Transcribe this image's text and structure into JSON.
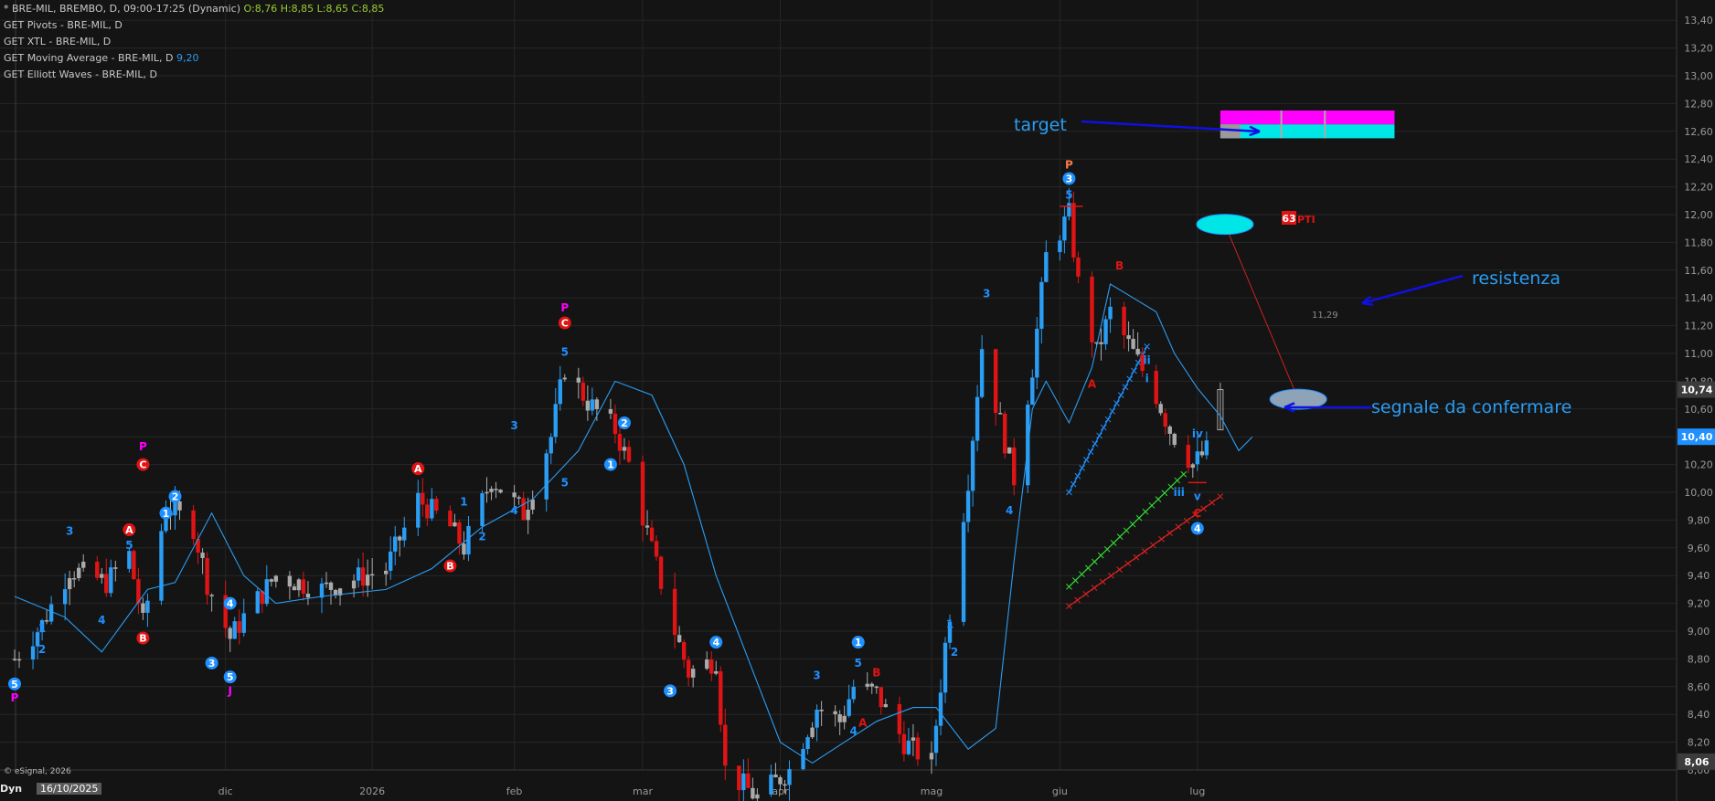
{
  "header": {
    "symbol_line": "* BRE-MIL, BREMBO, D, 09:00-17:25 (Dynamic)",
    "ohlc": "O:8,76 H:8,85 L:8,65 C:8,85",
    "studies": [
      {
        "label": "GET Pivots - BRE-MIL, D",
        "value": ""
      },
      {
        "label": "GET XTL - BRE-MIL, D",
        "value": ""
      },
      {
        "label": "GET Moving Average - BRE-MIL, D",
        "value": "9,20"
      },
      {
        "label": "GET Elliott Waves - BRE-MIL, D",
        "value": ""
      }
    ]
  },
  "footer": {
    "copyright": "© eSignal, 2026",
    "mode": "Dyn",
    "cursor_date": "16/10/2025"
  },
  "colors": {
    "background": "#141414",
    "grid": "#262626",
    "up_candle": "#2a9df4",
    "down_candle": "#e01414",
    "neutral_candle": "#aaaaaa",
    "moving_average": "#2a9df4",
    "annotation_arrow": "#1010e0",
    "annotation_text": "#2a9df4",
    "target_magenta": "#ff00ff",
    "target_cyan": "#00e6e6",
    "wave_red": "#e01414",
    "wave_blue": "#1e90ff",
    "wave_magenta": "#ff00ff"
  },
  "chart_data": {
    "type": "candlestick",
    "title": "",
    "xlabel": "",
    "ylabel": "",
    "ylim": [
      8.0,
      13.6
    ],
    "grid": true,
    "y_ticks": [
      "8,00",
      "8,20",
      "8,40",
      "8,60",
      "8,80",
      "9,00",
      "9,20",
      "9,40",
      "9,60",
      "9,80",
      "10,00",
      "10,20",
      "10,40",
      "10,60",
      "10,80",
      "11,00",
      "11,20",
      "11,40",
      "11,60",
      "11,80",
      "12,00",
      "12,20",
      "12,40",
      "12,60",
      "12,80",
      "13,00",
      "13,20",
      "13,40"
    ],
    "x_labels": [
      {
        "label": "dic",
        "date": "2025-12-01"
      },
      {
        "label": "2026",
        "date": "2026-01-02"
      },
      {
        "label": "feb",
        "date": "2026-02-02"
      },
      {
        "label": "mar",
        "date": "2026-03-02"
      },
      {
        "label": "apr",
        "date": "2026-04-01"
      },
      {
        "label": "mag",
        "date": "2026-05-04"
      },
      {
        "label": "giu",
        "date": "2026-06-01"
      },
      {
        "label": "lug",
        "date": "2026-07-01"
      }
    ],
    "date_range": [
      "2025-10-16",
      "2026-07-13"
    ],
    "price_badges": [
      {
        "value": 10.74,
        "label": "10,74",
        "style": "gray"
      },
      {
        "value": 10.4,
        "label": "10,40",
        "style": "blue"
      },
      {
        "value": 8.06,
        "label": "8,06",
        "style": "gray"
      }
    ],
    "series": [
      {
        "name": "",
        "type": "candlestick",
        "anchors": [
          {
            "date": "2025-10-16",
            "close": 8.8
          },
          {
            "date": "2025-10-22",
            "close": 9.05
          },
          {
            "date": "2025-10-28",
            "close": 9.45
          },
          {
            "date": "2025-11-05",
            "close": 9.35
          },
          {
            "date": "2025-11-10",
            "close": 9.55
          },
          {
            "date": "2025-11-13",
            "close": 9.05
          },
          {
            "date": "2025-11-18",
            "close": 9.9
          },
          {
            "date": "2025-11-24",
            "close": 9.75
          },
          {
            "date": "2025-11-27",
            "close": 9.35
          },
          {
            "date": "2025-12-02",
            "close": 8.95
          },
          {
            "date": "2025-12-05",
            "close": 9.1
          },
          {
            "date": "2025-12-12",
            "close": 9.4
          },
          {
            "date": "2025-12-22",
            "close": 9.3
          },
          {
            "date": "2026-01-05",
            "close": 9.45
          },
          {
            "date": "2026-01-12",
            "close": 9.95
          },
          {
            "date": "2026-01-19",
            "close": 9.75
          },
          {
            "date": "2026-01-22",
            "close": 9.6
          },
          {
            "date": "2026-01-28",
            "close": 10.1
          },
          {
            "date": "2026-02-04",
            "close": 9.85
          },
          {
            "date": "2026-02-10",
            "close": 10.4
          },
          {
            "date": "2026-02-13",
            "close": 10.9
          },
          {
            "date": "2026-02-18",
            "close": 10.65
          },
          {
            "date": "2026-02-24",
            "close": 10.45
          },
          {
            "date": "2026-02-27",
            "close": 10.2
          },
          {
            "date": "2026-03-03",
            "close": 9.7
          },
          {
            "date": "2026-03-09",
            "close": 9.0
          },
          {
            "date": "2026-03-12",
            "close": 8.7
          },
          {
            "date": "2026-03-18",
            "close": 8.8
          },
          {
            "date": "2026-03-20",
            "close": 8.0
          },
          {
            "date": "2026-03-27",
            "close": 7.8
          },
          {
            "date": "2026-04-03",
            "close": 8.0
          },
          {
            "date": "2026-04-09",
            "close": 8.45
          },
          {
            "date": "2026-04-14",
            "close": 8.35
          },
          {
            "date": "2026-04-17",
            "close": 8.6
          },
          {
            "date": "2026-04-22",
            "close": 8.55
          },
          {
            "date": "2026-04-28",
            "close": 8.2
          },
          {
            "date": "2026-05-04",
            "close": 8.05
          },
          {
            "date": "2026-05-07",
            "close": 8.9
          },
          {
            "date": "2026-05-12",
            "close": 10.1
          },
          {
            "date": "2026-05-15",
            "close": 11.05
          },
          {
            "date": "2026-05-19",
            "close": 10.5
          },
          {
            "date": "2026-05-22",
            "close": 10.1
          },
          {
            "date": "2026-05-26",
            "close": 10.9
          },
          {
            "date": "2026-05-29",
            "close": 11.7
          },
          {
            "date": "2026-06-03",
            "close": 12.0
          },
          {
            "date": "2026-06-05",
            "close": 11.5
          },
          {
            "date": "2026-06-09",
            "close": 11.0
          },
          {
            "date": "2026-06-12",
            "close": 11.3
          },
          {
            "date": "2026-06-17",
            "close": 11.0
          },
          {
            "date": "2026-06-22",
            "close": 10.7
          },
          {
            "date": "2026-06-25",
            "close": 10.45
          },
          {
            "date": "2026-06-30",
            "close": 10.2
          },
          {
            "date": "2026-07-03",
            "close": 10.3
          },
          {
            "date": "2026-07-06",
            "close": 10.74
          }
        ]
      },
      {
        "name": "",
        "type": "line",
        "points": [
          {
            "date": "2025-10-16",
            "value": 9.25
          },
          {
            "date": "2025-10-27",
            "value": 9.1
          },
          {
            "date": "2025-11-04",
            "value": 8.85
          },
          {
            "date": "2025-11-14",
            "value": 9.3
          },
          {
            "date": "2025-11-20",
            "value": 9.35
          },
          {
            "date": "2025-11-28",
            "value": 9.85
          },
          {
            "date": "2025-12-05",
            "value": 9.4
          },
          {
            "date": "2025-12-12",
            "value": 9.2
          },
          {
            "date": "2025-12-22",
            "value": 9.25
          },
          {
            "date": "2026-01-05",
            "value": 9.3
          },
          {
            "date": "2026-01-15",
            "value": 9.45
          },
          {
            "date": "2026-01-26",
            "value": 9.75
          },
          {
            "date": "2026-02-06",
            "value": 9.95
          },
          {
            "date": "2026-02-16",
            "value": 10.3
          },
          {
            "date": "2026-02-24",
            "value": 10.8
          },
          {
            "date": "2026-03-04",
            "value": 10.7
          },
          {
            "date": "2026-03-11",
            "value": 10.2
          },
          {
            "date": "2026-03-18",
            "value": 9.4
          },
          {
            "date": "2026-03-25",
            "value": 8.8
          },
          {
            "date": "2026-04-01",
            "value": 8.2
          },
          {
            "date": "2026-04-08",
            "value": 8.05
          },
          {
            "date": "2026-04-15",
            "value": 8.2
          },
          {
            "date": "2026-04-22",
            "value": 8.35
          },
          {
            "date": "2026-04-30",
            "value": 8.45
          },
          {
            "date": "2026-05-05",
            "value": 8.45
          },
          {
            "date": "2026-05-12",
            "value": 8.15
          },
          {
            "date": "2026-05-18",
            "value": 8.3
          },
          {
            "date": "2026-05-22",
            "value": 9.5
          },
          {
            "date": "2026-05-26",
            "value": 10.6
          },
          {
            "date": "2026-05-29",
            "value": 10.8
          },
          {
            "date": "2026-06-03",
            "value": 10.5
          },
          {
            "date": "2026-06-08",
            "value": 10.9
          },
          {
            "date": "2026-06-12",
            "value": 11.5
          },
          {
            "date": "2026-06-17",
            "value": 11.4
          },
          {
            "date": "2026-06-22",
            "value": 11.3
          },
          {
            "date": "2026-06-26",
            "value": 11.0
          },
          {
            "date": "2026-07-01",
            "value": 10.75
          },
          {
            "date": "2026-07-06",
            "value": 10.55
          },
          {
            "date": "2026-07-10",
            "value": 10.3
          },
          {
            "date": "2026-07-13",
            "value": 10.4
          }
        ]
      }
    ],
    "wave_labels": [
      {
        "date": "2025-10-16",
        "value": 8.62,
        "text": "5",
        "style": "blue-circle"
      },
      {
        "date": "2025-10-16",
        "value": 8.52,
        "text": "P",
        "style": "magenta"
      },
      {
        "date": "2025-10-22",
        "value": 8.87,
        "text": "2",
        "style": "blue"
      },
      {
        "date": "2025-10-22",
        "value": 9.02,
        "text": "1",
        "style": "blue"
      },
      {
        "date": "2025-10-28",
        "value": 9.72,
        "text": "3",
        "style": "blue"
      },
      {
        "date": "2025-11-04",
        "value": 9.08,
        "text": "4",
        "style": "blue"
      },
      {
        "date": "2025-11-10",
        "value": 9.62,
        "text": "5",
        "style": "blue"
      },
      {
        "date": "2025-11-10",
        "value": 9.73,
        "text": "A",
        "style": "red-circle"
      },
      {
        "date": "2025-11-13",
        "value": 8.95,
        "text": "B",
        "style": "red-circle"
      },
      {
        "date": "2025-11-13",
        "value": 10.2,
        "text": "C",
        "style": "red-circle"
      },
      {
        "date": "2025-11-13",
        "value": 10.33,
        "text": "P",
        "style": "magenta"
      },
      {
        "date": "2025-11-18",
        "value": 9.85,
        "text": "1",
        "style": "blue-circle"
      },
      {
        "date": "2025-11-20",
        "value": 9.97,
        "text": "2",
        "style": "blue-circle"
      },
      {
        "date": "2025-12-02",
        "value": 9.2,
        "text": "4",
        "style": "blue-circle"
      },
      {
        "date": "2025-11-28",
        "value": 8.77,
        "text": "3",
        "style": "blue-circle"
      },
      {
        "date": "2025-12-02",
        "value": 8.67,
        "text": "5",
        "style": "blue-circle"
      },
      {
        "date": "2025-12-02",
        "value": 8.57,
        "text": "J",
        "style": "magenta"
      },
      {
        "date": "2026-01-12",
        "value": 10.17,
        "text": "A",
        "style": "red-circle"
      },
      {
        "date": "2026-01-19",
        "value": 9.47,
        "text": "B",
        "style": "red-circle"
      },
      {
        "date": "2026-01-22",
        "value": 9.93,
        "text": "1",
        "style": "blue"
      },
      {
        "date": "2026-01-26",
        "value": 9.68,
        "text": "2",
        "style": "blue"
      },
      {
        "date": "2026-02-02",
        "value": 10.48,
        "text": "3",
        "style": "blue"
      },
      {
        "date": "2026-02-02",
        "value": 9.87,
        "text": "4",
        "style": "blue"
      },
      {
        "date": "2026-02-13",
        "value": 10.07,
        "text": "5",
        "style": "blue"
      },
      {
        "date": "2026-02-13",
        "value": 11.01,
        "text": "5",
        "style": "blue"
      },
      {
        "date": "2026-02-13",
        "value": 11.22,
        "text": "C",
        "style": "red-circle"
      },
      {
        "date": "2026-02-13",
        "value": 11.33,
        "text": "P",
        "style": "magenta"
      },
      {
        "date": "2026-02-23",
        "value": 10.2,
        "text": "1",
        "style": "blue-circle"
      },
      {
        "date": "2026-02-26",
        "value": 10.5,
        "text": "2",
        "style": "blue-circle"
      },
      {
        "date": "2026-03-08",
        "value": 8.57,
        "text": "3",
        "style": "blue-circle"
      },
      {
        "date": "2026-03-18",
        "value": 8.92,
        "text": "4",
        "style": "blue-circle"
      },
      {
        "date": "2026-04-09",
        "value": 8.68,
        "text": "3",
        "style": "blue"
      },
      {
        "date": "2026-04-17",
        "value": 8.28,
        "text": "4",
        "style": "blue"
      },
      {
        "date": "2026-04-18",
        "value": 8.92,
        "text": "1",
        "style": "blue-circle"
      },
      {
        "date": "2026-04-18",
        "value": 8.77,
        "text": "5",
        "style": "blue"
      },
      {
        "date": "2026-04-22",
        "value": 8.7,
        "text": "B",
        "style": "red"
      },
      {
        "date": "2026-04-19",
        "value": 8.34,
        "text": "A",
        "style": "red"
      },
      {
        "date": "2026-05-08",
        "value": 9.05,
        "text": "1",
        "style": "blue"
      },
      {
        "date": "2026-05-09",
        "value": 8.85,
        "text": "2",
        "style": "blue"
      },
      {
        "date": "2026-05-16",
        "value": 11.43,
        "text": "3",
        "style": "blue"
      },
      {
        "date": "2026-05-21",
        "value": 9.87,
        "text": "4",
        "style": "blue"
      },
      {
        "date": "2026-06-03",
        "value": 12.36,
        "text": "P",
        "style": "orange"
      },
      {
        "date": "2026-06-03",
        "value": 12.26,
        "text": "3",
        "style": "blue-circle"
      },
      {
        "date": "2026-06-03",
        "value": 12.14,
        "text": "5",
        "style": "blue"
      },
      {
        "date": "2026-06-08",
        "value": 10.78,
        "text": "A",
        "style": "red"
      },
      {
        "date": "2026-06-14",
        "value": 11.63,
        "text": "B",
        "style": "red"
      },
      {
        "date": "2026-06-20",
        "value": 10.95,
        "text": "ii",
        "style": "blue"
      },
      {
        "date": "2026-06-20",
        "value": 10.82,
        "text": "i",
        "style": "blue"
      },
      {
        "date": "2026-06-27",
        "value": 10.0,
        "text": "iii",
        "style": "blue"
      },
      {
        "date": "2026-07-01",
        "value": 10.42,
        "text": "iv",
        "style": "blue"
      },
      {
        "date": "2026-07-01",
        "value": 9.97,
        "text": "v",
        "style": "blue"
      },
      {
        "date": "2026-07-01",
        "value": 9.85,
        "text": "C",
        "style": "red"
      },
      {
        "date": "2026-07-01",
        "value": 9.74,
        "text": "4",
        "style": "blue-circle"
      }
    ],
    "annotations": [
      {
        "text": "target",
        "date": "2026-05-27",
        "value": 12.7
      },
      {
        "text": "resistenza",
        "date": "2026-07-31",
        "value": 11.58
      },
      {
        "text": "segnale da confermare",
        "date": "2026-07-11",
        "value": 10.64
      },
      {
        "text": "63",
        "date": "2026-07-06",
        "value": 12.0
      },
      {
        "text": "PTI",
        "date": "2026-07-08",
        "value": 12.0
      },
      {
        "text": "11,29",
        "date": "2026-07-15",
        "value": 11.31
      }
    ],
    "target_zone": {
      "date_start": "2026-07-06",
      "date_end": "2026-08-13",
      "upper": [
        12.65,
        12.75
      ],
      "lower": [
        12.55,
        12.65
      ]
    },
    "projection_line": {
      "from": {
        "date": "2026-07-07",
        "value": 11.93
      },
      "to": {
        "date": "2026-07-23",
        "value": 10.67
      },
      "ellipses": [
        {
          "date": "2026-07-07",
          "value": 11.93
        },
        {
          "date": "2026-07-23",
          "value": 10.67
        }
      ]
    },
    "channels": [
      {
        "color": "blue",
        "from": {
          "date": "2026-06-03",
          "value": 10.0
        },
        "to": {
          "date": "2026-06-20",
          "value": 11.05
        }
      },
      {
        "color": "green",
        "from": {
          "date": "2026-06-03",
          "value": 9.32
        },
        "to": {
          "date": "2026-06-28",
          "value": 10.13
        }
      },
      {
        "color": "red",
        "from": {
          "date": "2026-06-03",
          "value": 9.18
        },
        "to": {
          "date": "2026-07-06",
          "value": 9.97
        }
      }
    ]
  }
}
